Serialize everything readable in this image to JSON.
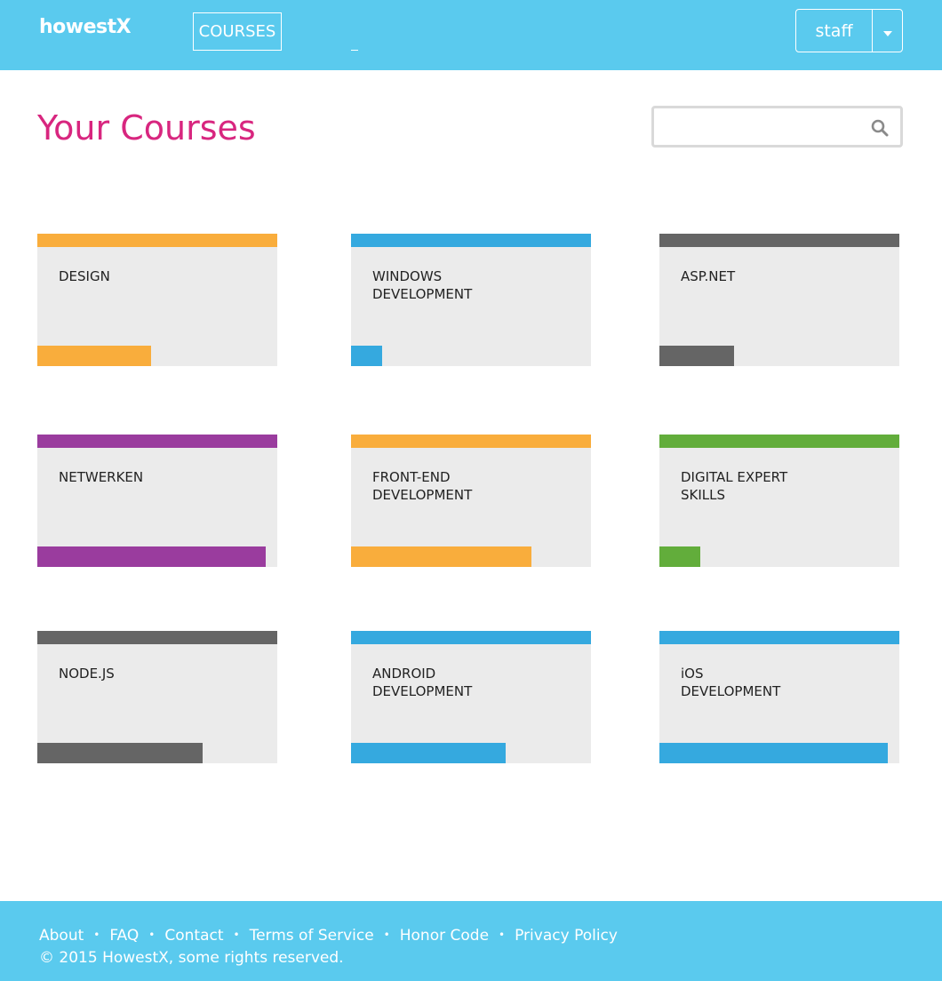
{
  "header": {
    "logo": "howestX",
    "nav": {
      "courses_label": "COURSES"
    },
    "user": {
      "name": "staff"
    },
    "colors": {
      "bar": "#5acaee"
    }
  },
  "main": {
    "title": "Your Courses",
    "search": {
      "placeholder": "",
      "icon": "search-icon"
    }
  },
  "courses": [
    {
      "line1": "DESIGN",
      "line2": "",
      "color": "#f9ad3c",
      "progress": 0.475
    },
    {
      "line1": "WINDOWS",
      "line2": "DEVELOPMENT",
      "color": "#35a9df",
      "progress": 0.13
    },
    {
      "line1": "ASP.NET",
      "line2": "",
      "color": "#656565",
      "progress": 0.31
    },
    {
      "line1": "NETWERKEN",
      "line2": "",
      "color": "#9a3c9e",
      "progress": 0.95
    },
    {
      "line1": "FRONT-END",
      "line2": "DEVELOPMENT",
      "color": "#f9ad3c",
      "progress": 0.75
    },
    {
      "line1": "DIGITAL EXPERT",
      "line2": "SKILLS",
      "color": "#62ad3b",
      "progress": 0.17
    },
    {
      "line1": "NODE.JS",
      "line2": "",
      "color": "#656565",
      "progress": 0.69
    },
    {
      "line1": "ANDROID",
      "line2": "DEVELOPMENT",
      "color": "#35a9df",
      "progress": 0.645
    },
    {
      "line1": "iOS",
      "line2": "DEVELOPMENT",
      "color": "#35a9df",
      "progress": 0.95
    }
  ],
  "footer": {
    "links": [
      "About",
      "FAQ",
      "Contact",
      "Terms of Service",
      "Honor Code",
      "Privacy Policy"
    ],
    "separator": "•",
    "copyright": "© 2015 HowestX, some rights reserved."
  }
}
